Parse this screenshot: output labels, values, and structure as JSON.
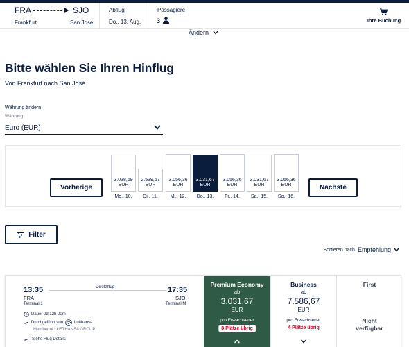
{
  "header": {
    "from_code": "FRA",
    "to_code": "SJO",
    "from_city": "Frankfurt",
    "to_city": "San José",
    "date_label": "Abflug",
    "date_value": "Do., 13. Aug.",
    "pax_label": "Passagiere",
    "pax_count": "3",
    "pax_icon": "person-icon",
    "cart_label": "Ihre Buchung",
    "cart_icon": "cart-icon",
    "change_label": "Ändern"
  },
  "page": {
    "title": "Bitte wählen Sie Ihren Hinflug",
    "subtitle": "Von Frankfurt nach San José"
  },
  "currency": {
    "title": "Währung ändern",
    "label": "Währung",
    "value": "Euro (EUR)"
  },
  "dates": {
    "prev_label": "Vorherige",
    "next_label": "Nächste",
    "days": [
      {
        "label": "Mo., 10.",
        "price": "3.038,69",
        "currency": "EUR",
        "selected": false
      },
      {
        "label": "Di., 11.",
        "price": "2.539,67",
        "currency": "EUR",
        "selected": false
      },
      {
        "label": "Mi., 12.",
        "price": "3.056,36",
        "currency": "EUR",
        "selected": false
      },
      {
        "label": "Do., 13.",
        "price": "3.031,67",
        "currency": "EUR",
        "selected": true
      },
      {
        "label": "Fr., 14.",
        "price": "3.056,36",
        "currency": "EUR",
        "selected": false
      },
      {
        "label": "Sa., 15.",
        "price": "3.031,67",
        "currency": "EUR",
        "selected": false
      },
      {
        "label": "So., 16.",
        "price": "3.056,36",
        "currency": "EUR",
        "selected": false
      }
    ]
  },
  "filter": {
    "label": "Filter",
    "icon": "sliders-icon"
  },
  "sort": {
    "label": "Sortieren nach",
    "value": "Empfehlung"
  },
  "flight": {
    "dep_time": "13:35",
    "arr_time": "17:35",
    "dep_code": "FRA",
    "arr_code": "SJO",
    "dep_terminal": "Terminal 1",
    "arr_terminal": "Terminal M",
    "type": "Direktflug",
    "duration": "Dauer 0d 12h 00m",
    "operated_by": "Durchgeführt von",
    "airline": "Lufthansa",
    "member": "Member of LUFTHANSA GROUP",
    "details_link": "Siehe Flug Details",
    "fares": {
      "premium": {
        "name": "Premium Economy",
        "ab": "ab",
        "price": "3.031,67",
        "currency": "EUR",
        "per": "pro Erwachsener",
        "seats": "8 Plätze übrig"
      },
      "business": {
        "name": "Business",
        "ab": "ab",
        "price": "7.586,67",
        "currency": "EUR",
        "per": "pro Erwachsener",
        "seats": "4 Plätze übrig"
      },
      "first": {
        "name": "First",
        "na_line1": "Nicht",
        "na_line2": "verfügbar"
      }
    }
  },
  "colors": {
    "navy": "#0a1d3d",
    "premium_green": "#2e5a46",
    "seats_red": "#c8102e"
  }
}
